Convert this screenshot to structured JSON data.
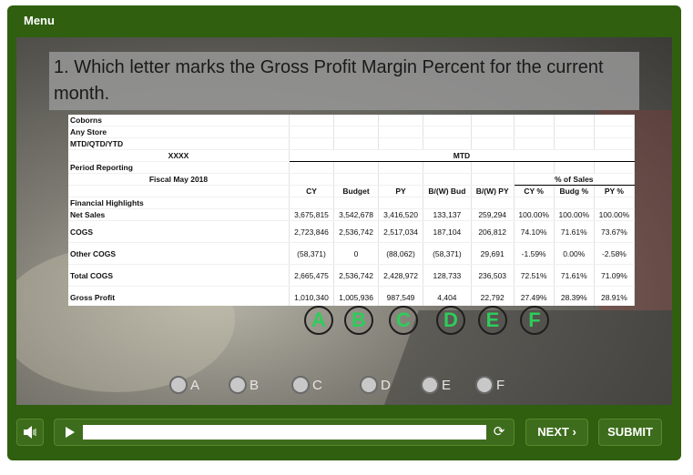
{
  "menu": {
    "label": "Menu"
  },
  "question": {
    "text": "1.  Which letter marks the Gross Profit Margin Percent for the current month."
  },
  "report": {
    "store_rows": [
      "Coborns",
      "Any Store",
      "MTD/QTD/YTD"
    ],
    "placeholder": "XXXX",
    "mtd_label": "MTD",
    "period_label": "Period Reporting",
    "fiscal_label": "Fiscal May 2018",
    "pct_sales_label": "% of Sales",
    "columns": [
      "CY",
      "Budget",
      "PY",
      "B/(W) Bud",
      "B/(W) PY",
      "CY %",
      "Budg %",
      "PY %"
    ],
    "section_label": "Financial Highlights",
    "rows": [
      {
        "label": "Net Sales",
        "values": [
          "3,675,815",
          "3,542,678",
          "3,416,520",
          "133,137",
          "259,294",
          "100.00%",
          "100.00%",
          "100.00%"
        ]
      },
      {
        "label": "COGS",
        "values": [
          "2,723,846",
          "2,536,742",
          "2,517,034",
          "187,104",
          "206,812",
          "74.10%",
          "71.61%",
          "73.67%"
        ]
      },
      {
        "label": "Other COGS",
        "values": [
          "(58,371)",
          "0",
          "(88,062)",
          "(58,371)",
          "29,691",
          "-1.59%",
          "0.00%",
          "-2.58%"
        ]
      },
      {
        "label": "Total COGS",
        "values": [
          "2,665,475",
          "2,536,742",
          "2,428,972",
          "128,733",
          "236,503",
          "72.51%",
          "71.61%",
          "71.09%"
        ]
      },
      {
        "label": "Gross Profit",
        "values": [
          "1,010,340",
          "1,005,936",
          "987,549",
          "4,404",
          "22,792",
          "27.49%",
          "28.39%",
          "28.91%"
        ]
      }
    ]
  },
  "markers": [
    "A",
    "B",
    "C",
    "D",
    "E",
    "F"
  ],
  "options": [
    "A",
    "B",
    "C",
    "D",
    "E",
    "F"
  ],
  "player": {
    "progress": 1.0
  },
  "buttons": {
    "next": "NEXT ›",
    "submit": "SUBMIT"
  },
  "icons": {
    "volume": "volume-icon",
    "play": "play-icon",
    "replay": "replay-icon"
  },
  "colors": {
    "frame": "#2f5f0f",
    "button": "#3d6d1c",
    "marker": "#2ecc5a"
  }
}
